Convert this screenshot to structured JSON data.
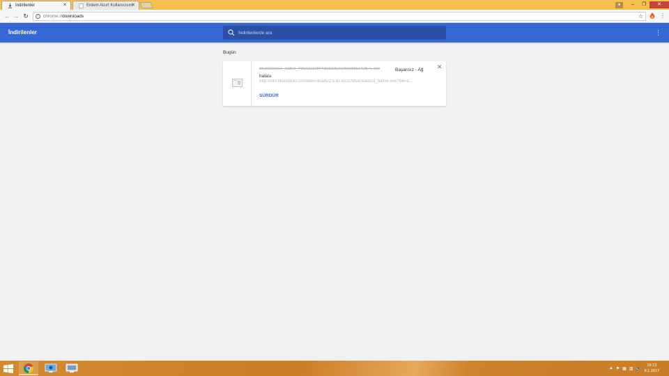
{
  "browser": {
    "tabs": [
      {
        "title": "İndirilenler",
        "active": true
      },
      {
        "title": "Erdem Alsırt Kullanıcısını",
        "active": false
      }
    ],
    "url_scheme": "chrome://",
    "url_path": "downloads"
  },
  "page": {
    "title": "İndirilenler",
    "search_placeholder": "İndirilenlerde ara",
    "section_date": "Bugün"
  },
  "download": {
    "filename": "BlueStacks2_native_095e2233b04ded325ece6ce8b5e4267c.exe",
    "status": "Başarısız - Ağ hatası",
    "url": "http://cdn.bluestacks.com/downloads/2.5.61.6332/BlueStacks2_native.exe?filena...",
    "resume_label": "SÜRDÜR"
  },
  "taskbar": {
    "time": "19:13",
    "date": "9.1.2017"
  },
  "colors": {
    "header_blue": "#3568d4",
    "tabstrip": "#f6c04f",
    "taskbar": "#cb7f27"
  }
}
